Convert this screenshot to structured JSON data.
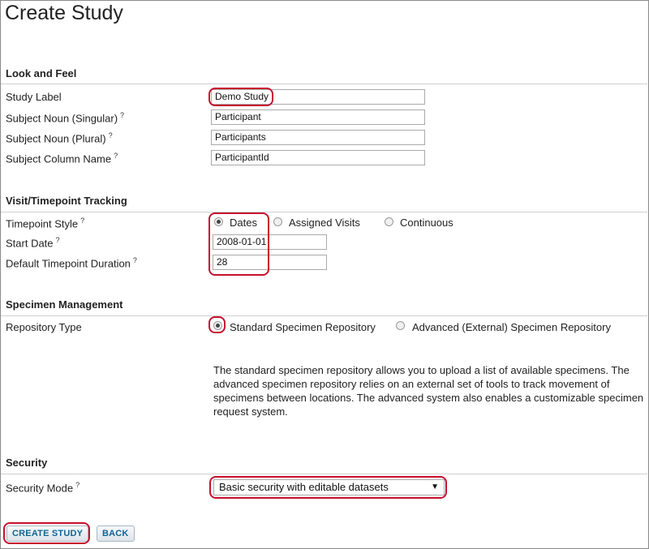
{
  "page": {
    "title": "Create Study"
  },
  "help_marker": "?",
  "look_and_feel": {
    "heading": "Look and Feel",
    "study_label": {
      "label": "Study Label",
      "value": "Demo Study"
    },
    "subject_noun_singular": {
      "label": "Subject Noun (Singular)",
      "value": "Participant"
    },
    "subject_noun_plural": {
      "label": "Subject Noun (Plural)",
      "value": "Participants"
    },
    "subject_column_name": {
      "label": "Subject Column Name",
      "value": "ParticipantId"
    }
  },
  "visit_tracking": {
    "heading": "Visit/Timepoint Tracking",
    "timepoint_style": {
      "label": "Timepoint Style",
      "options": [
        "Dates",
        "Assigned Visits",
        "Continuous"
      ],
      "selected": "Dates"
    },
    "start_date": {
      "label": "Start Date",
      "value": "2008-01-01"
    },
    "default_duration": {
      "label": "Default Timepoint Duration",
      "value": "28"
    }
  },
  "specimen_management": {
    "heading": "Specimen Management",
    "repository_type": {
      "label": "Repository Type",
      "options": [
        "Standard Specimen Repository",
        "Advanced (External) Specimen Repository"
      ],
      "selected": "Standard Specimen Repository"
    },
    "description": "The standard specimen repository allows you to upload a list of available specimens. The advanced specimen repository relies on an external set of tools to track movement of specimens between locations. The advanced system also enables a customizable specimen request system."
  },
  "security": {
    "heading": "Security",
    "security_mode": {
      "label": "Security Mode",
      "value": "Basic security with editable datasets"
    }
  },
  "buttons": {
    "create": "CREATE STUDY",
    "back": "BACK"
  },
  "colors": {
    "highlight": "#c8102e",
    "button_text": "#126495"
  }
}
